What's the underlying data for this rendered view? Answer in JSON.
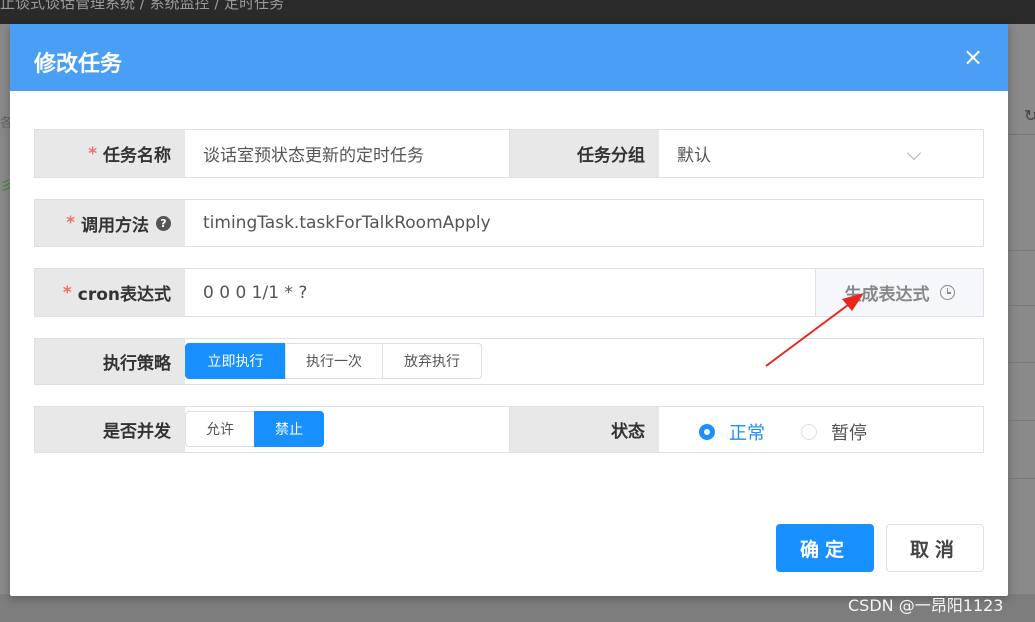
{
  "background": {
    "breadcrumb": "止谈式谈话管理系统  /  系统监控  /  定时任务",
    "left_fragment_1": "各",
    "left_fragment_2": "彡"
  },
  "dialog": {
    "title": "修改任务",
    "close_label": "×"
  },
  "form": {
    "task_name": {
      "label": "任务名称",
      "value": "谈话室预状态更新的定时任务"
    },
    "task_group": {
      "label": "任务分组",
      "value": "默认"
    },
    "invoke_target": {
      "label": "调用方法",
      "help": "?",
      "value": "timingTask.taskForTalkRoomApply"
    },
    "cron": {
      "label": "cron表达式",
      "value": "0 0 0 1/1 * ?",
      "generate_label": "生成表达式"
    },
    "misfire_policy": {
      "label": "执行策略",
      "options": [
        "立即执行",
        "执行一次",
        "放弃执行"
      ],
      "selected": "立即执行"
    },
    "concurrent": {
      "label": "是否并发",
      "options": [
        "允许",
        "禁止"
      ],
      "selected": "禁止"
    },
    "status": {
      "label": "状态",
      "options": [
        "正常",
        "暂停"
      ],
      "selected": "正常"
    },
    "required_mark": "*"
  },
  "footer": {
    "confirm_label": "确定",
    "cancel_label": "取消"
  },
  "watermark": "CSDN @一昂阳1123",
  "colors": {
    "primary": "#1890ff",
    "header": "#4a9ff5",
    "required": "#f56c6c",
    "annotation_arrow": "#e8261e"
  }
}
